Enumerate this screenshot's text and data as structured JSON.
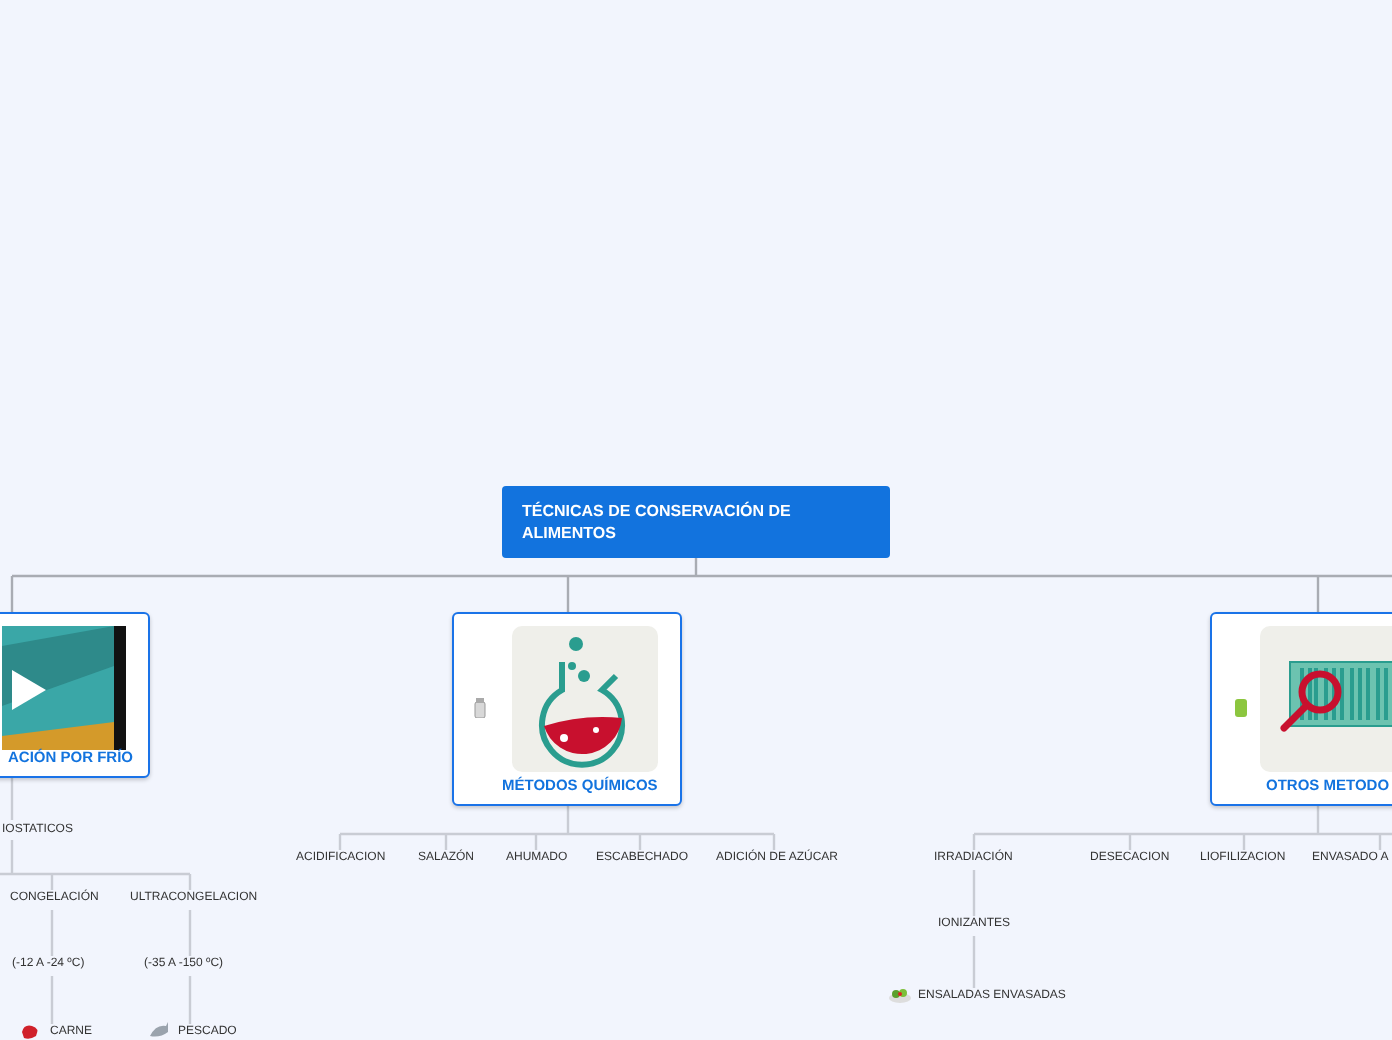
{
  "root": {
    "title": "TÉCNICAS DE CONSERVACIÓN DE ALIMENTOS"
  },
  "branches": [
    {
      "title": "ACIÓN POR FRÍO",
      "kind": "video",
      "children": [
        {
          "label": "IOSTATICOS",
          "children": [
            {
              "label": "CONGELACIÓN",
              "children": [
                {
                  "label": "(-12 A -24 ºC)",
                  "children": [
                    {
                      "label": "CARNE"
                    }
                  ]
                }
              ]
            },
            {
              "label": "ULTRACONGELACION",
              "children": [
                {
                  "label": "(-35 A -150 ºC)",
                  "children": [
                    {
                      "label": "PESCADO"
                    }
                  ]
                }
              ]
            }
          ]
        }
      ]
    },
    {
      "title": "MÉTODOS QUÍMICOS",
      "kind": "flask",
      "children": [
        {
          "label": "ACIDIFICACION"
        },
        {
          "label": "SALAZÓN"
        },
        {
          "label": "AHUMADO"
        },
        {
          "label": "ESCABECHADO"
        },
        {
          "label": "ADICIÓN DE AZÚCAR"
        }
      ]
    },
    {
      "title": "OTROS METODO",
      "kind": "barcode",
      "children": [
        {
          "label": "IRRADIACIÓN",
          "children": [
            {
              "label": "IONIZANTES",
              "children": [
                {
                  "label": "ENSALADAS ENVASADAS"
                }
              ]
            }
          ]
        },
        {
          "label": "DESECACION"
        },
        {
          "label": "LIOFILIZACION"
        },
        {
          "label": "ENVASADO A"
        }
      ]
    }
  ]
}
